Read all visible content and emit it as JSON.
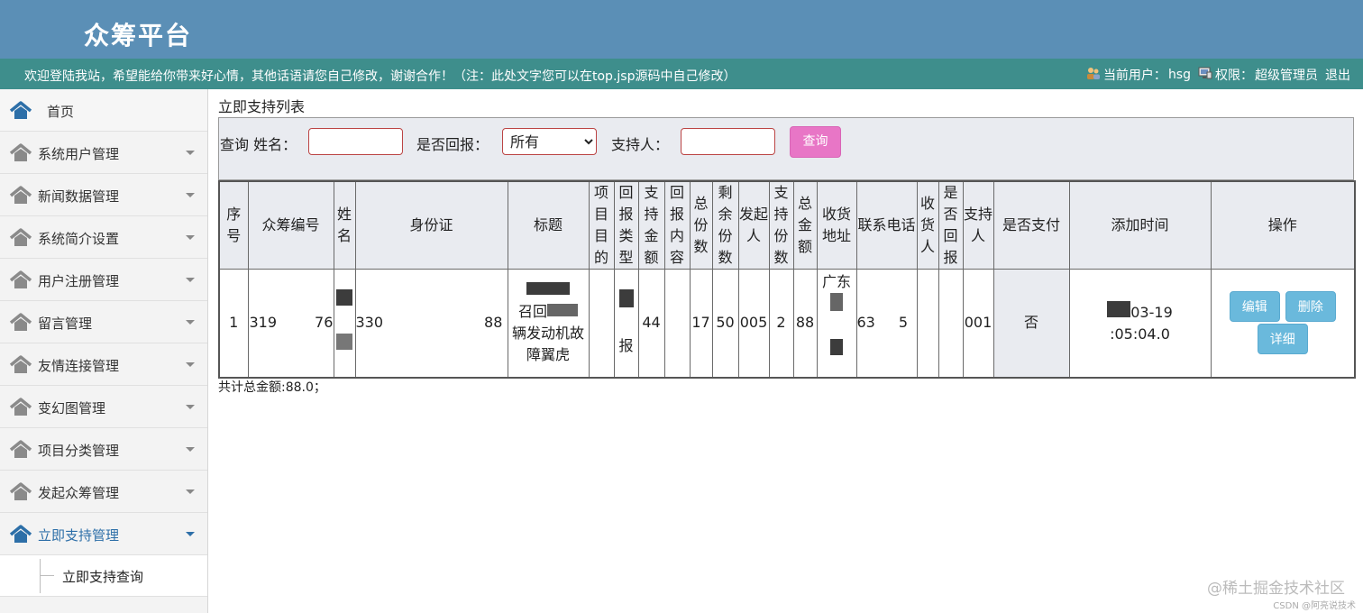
{
  "header": {
    "title": "众筹平台",
    "welcome": "欢迎登陆我站，希望能给你带来好心情，其他话语请您自己修改，谢谢合作！（注：此处文字您可以在top.jsp源码中自己修改）",
    "current_user_label": "当前用户：",
    "current_user": "hsg",
    "role_label": "权限：",
    "role": "超级管理员",
    "logout": "退出"
  },
  "sidebar": {
    "home": "首页",
    "items": [
      {
        "label": "系统用户管理"
      },
      {
        "label": "新闻数据管理"
      },
      {
        "label": "系统简介设置"
      },
      {
        "label": "用户注册管理"
      },
      {
        "label": "留言管理"
      },
      {
        "label": "友情连接管理"
      },
      {
        "label": "变幻图管理"
      },
      {
        "label": "项目分类管理"
      },
      {
        "label": "发起众筹管理"
      },
      {
        "label": "立即支持管理"
      }
    ],
    "sub_items": [
      {
        "label": "立即支持查询"
      }
    ]
  },
  "main": {
    "page_title": "立即支持列表",
    "search": {
      "query_label": "查询 姓名：",
      "name_value": "",
      "reward_label": "是否回报：",
      "reward_selected": "所有",
      "supporter_label": "支持人：",
      "supporter_value": "",
      "query_button": "查询"
    },
    "table": {
      "headers": [
        "序号",
        "众筹编号",
        "姓名",
        "身份证",
        "标题",
        "项目目的",
        "回报类型",
        "支持金额",
        "回报内容",
        "总份数",
        "剩余份数",
        "发起人",
        "支持份数",
        "总金额",
        "收货地址",
        "联系电话",
        "收货人",
        "是否回报",
        "支持人",
        "是否支付",
        "添加时间",
        "操作"
      ],
      "rows": [
        {
          "index": "1",
          "crowdfund_no": "319",
          "crowdfund_no_tail": "76",
          "name": "",
          "id_card": "330",
          "id_card_tail": "88",
          "title_line1": "召回",
          "title_line2": "辆发动机故",
          "title_line3": "障翼虎",
          "purpose": "",
          "reward_type": "报",
          "support_amount": "44",
          "reward_content": "",
          "total_shares": "17",
          "remaining_shares": "50",
          "initiator": "005",
          "support_shares": "2",
          "total_amount": "88",
          "address": "广东",
          "phone_head": "63",
          "phone_tail": "5",
          "receiver": "",
          "is_reward": "",
          "supporter": "001",
          "is_paid": "否",
          "added_time_line1": "03-19",
          "added_time_line2": ":05:04.0",
          "edit": "编辑",
          "delete": "删除",
          "detail": "详细"
        }
      ]
    },
    "total": "共计总金额:88.0；"
  },
  "watermark": {
    "main": "@稀土掘金技术社区",
    "sub": "CSDN @阿亮说技术"
  },
  "colors": {
    "header_bg": "#5b8fb6",
    "welcome_bg": "#3e8e8c",
    "query_button": "#e876c6",
    "op_button": "#6ab9dc",
    "active_menu": "#2d6fa8"
  }
}
